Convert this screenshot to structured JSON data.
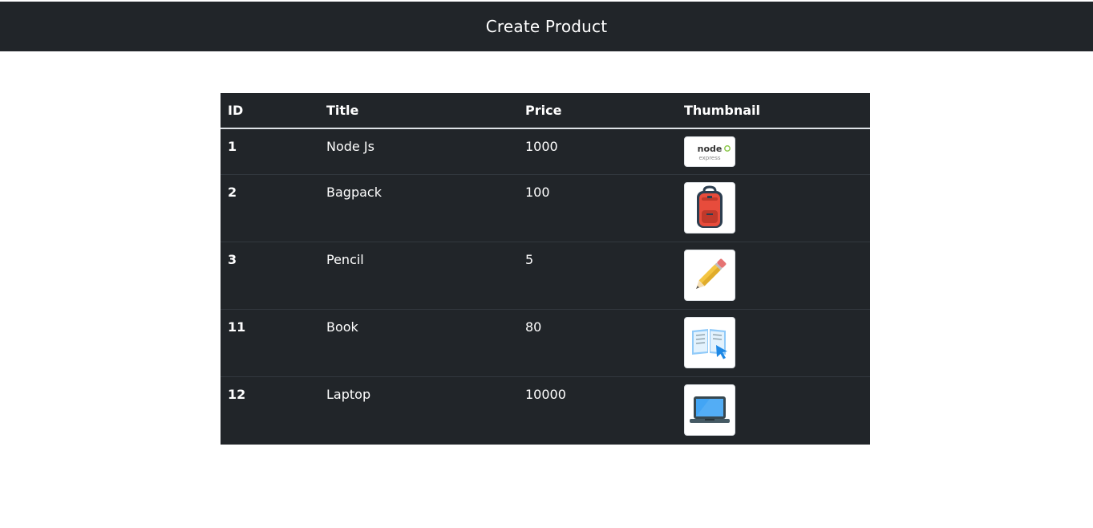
{
  "navbar": {
    "title": "Create Product"
  },
  "table": {
    "headers": {
      "id": "ID",
      "title": "Title",
      "price": "Price",
      "thumbnail": "Thumbnail"
    },
    "rows": [
      {
        "id": "1",
        "title": "Node Js",
        "price": "1000",
        "thumbnail": "nodejs-express-logo",
        "logo_text": "node",
        "logo_sub": "express"
      },
      {
        "id": "2",
        "title": "Bagpack",
        "price": "100",
        "thumbnail": "backpack-icon"
      },
      {
        "id": "3",
        "title": "Pencil",
        "price": "5",
        "thumbnail": "pencil-icon"
      },
      {
        "id": "11",
        "title": "Book",
        "price": "80",
        "thumbnail": "book-icon"
      },
      {
        "id": "12",
        "title": "Laptop",
        "price": "10000",
        "thumbnail": "laptop-icon"
      }
    ]
  },
  "colors": {
    "dark": "#212529",
    "row_border": "#32383e",
    "header_border": "#dee2e6"
  }
}
